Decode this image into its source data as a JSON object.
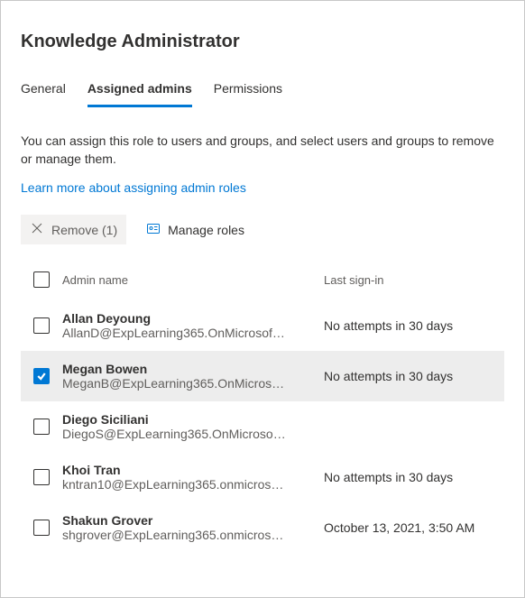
{
  "title": "Knowledge Administrator",
  "tabs": {
    "general": "General",
    "assigned": "Assigned admins",
    "permissions": "Permissions"
  },
  "description": "You can assign this role to users and groups, and select users and groups to remove or manage them.",
  "learn_link": "Learn more about assigning admin roles",
  "toolbar": {
    "remove_label": "Remove (1)",
    "manage_label": "Manage roles"
  },
  "columns": {
    "name": "Admin name",
    "signin": "Last sign-in"
  },
  "rows": [
    {
      "name": "Allan Deyoung",
      "email": "AllanD@ExpLearning365.OnMicrosoft....",
      "signin": "No attempts in 30 days",
      "selected": false
    },
    {
      "name": "Megan Bowen",
      "email": "MeganB@ExpLearning365.OnMicrosof...",
      "signin": "No attempts in 30 days",
      "selected": true
    },
    {
      "name": "Diego Siciliani",
      "email": "DiegoS@ExpLearning365.OnMicrosoft....",
      "signin": "",
      "selected": false
    },
    {
      "name": "Khoi Tran",
      "email": "kntran10@ExpLearning365.onmicrosof...",
      "signin": "No attempts in 30 days",
      "selected": false
    },
    {
      "name": "Shakun Grover",
      "email": "shgrover@ExpLearning365.onmicrosof...",
      "signin": "October 13, 2021, 3:50 AM",
      "selected": false
    }
  ]
}
